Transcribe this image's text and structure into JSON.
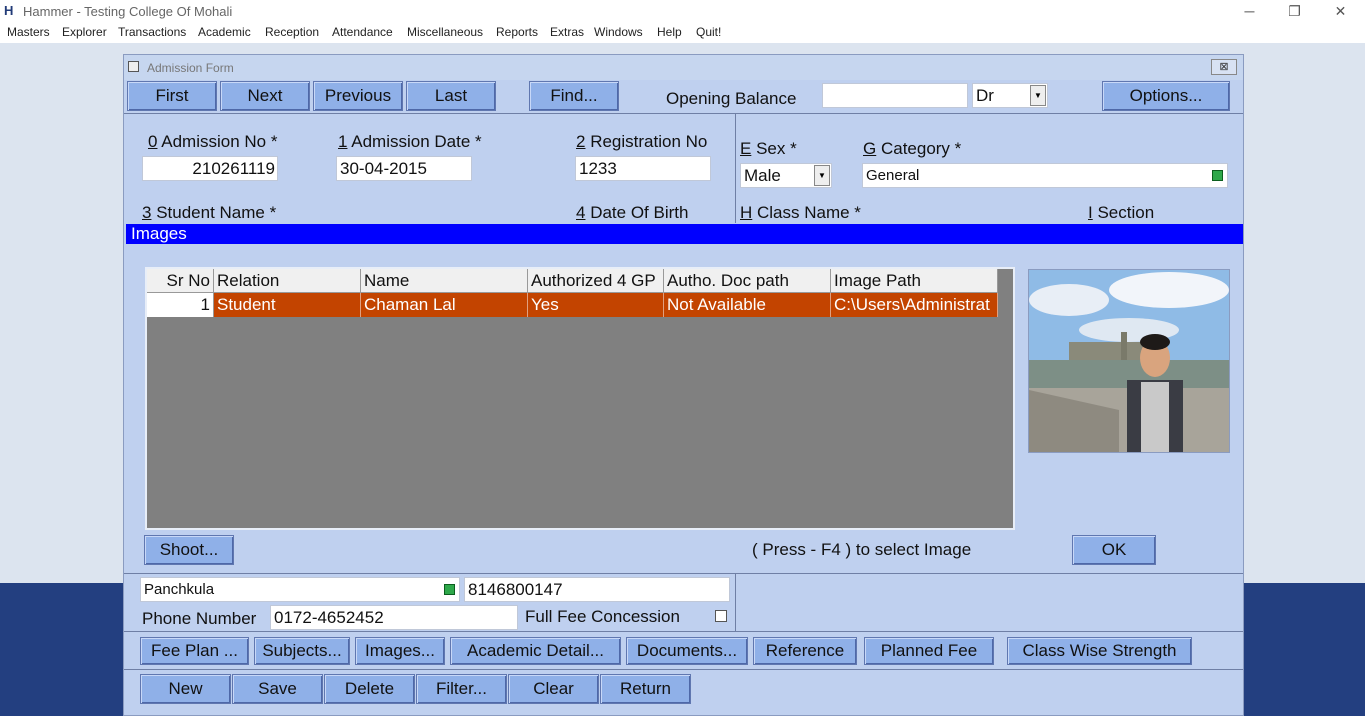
{
  "app": {
    "title": "Hammer  - Testing College Of Mohali",
    "minimize": "─",
    "restore": "❐",
    "close": "✕"
  },
  "menu": [
    "Masters",
    "Explorer",
    "Transactions",
    "Academic",
    "Reception",
    "Attendance",
    "Miscellaneous",
    "Reports",
    "Extras",
    "Windows",
    "Help",
    "Quit!"
  ],
  "form": {
    "title": "Admission Form",
    "close": "⊠"
  },
  "nav": {
    "first": "First",
    "next": "Next",
    "previous": "Previous",
    "last": "Last",
    "find": "Find...",
    "options": "Options..."
  },
  "opening_balance": {
    "label": "Opening Balance",
    "value": "",
    "drcr": "Dr"
  },
  "fields": {
    "admission_no": {
      "key": "0",
      "label": " Admission No *",
      "value": "210261119"
    },
    "admission_date": {
      "key": "1",
      "label": " Admission Date *",
      "value": "30-04-2015"
    },
    "registration_no": {
      "key": "2",
      "label": " Registration No",
      "value": "1233"
    },
    "sex": {
      "key": "E",
      "label": " Sex *",
      "value": "Male"
    },
    "category": {
      "key": "G",
      "label": " Category *",
      "value": "General"
    },
    "student_name": {
      "key": "3",
      "label": " Student Name *"
    },
    "dob": {
      "key": "4",
      "label": " Date Of Birth"
    },
    "class_name": {
      "key": "H",
      "label": " Class Name *"
    },
    "section": {
      "key": "I",
      "label": " Section"
    }
  },
  "images_panel": {
    "title": "Images",
    "columns": [
      "Sr No",
      "Relation",
      "Name",
      "Authorized 4 GP",
      "Autho. Doc path",
      "Image Path"
    ],
    "rows": [
      {
        "sr": "1",
        "relation": "Student",
        "name": "Chaman Lal",
        "authorized": "Yes",
        "doc_path": "Not Available",
        "image_path": "C:\\Users\\Administrat"
      }
    ],
    "shoot": "Shoot...",
    "hint": "( Press -  F4 )  to select  Image",
    "ok": "OK"
  },
  "lower": {
    "city": "Panchkula",
    "mobile": "8146800147",
    "phone_label": "Phone Number",
    "phone": "0172-4652452",
    "fee_concession_label": "Full Fee Concession"
  },
  "tabs": {
    "fee_plan": "Fee Plan ...",
    "subjects": "Subjects...",
    "images": "Images...",
    "academic": "Academic Detail...",
    "documents": "Documents...",
    "reference": "Reference",
    "planned_fee": "Planned Fee",
    "class_wise": "Class Wise Strength"
  },
  "actions": {
    "new": "New",
    "save": "Save",
    "delete": "Delete",
    "filter": "Filter...",
    "clear": "Clear",
    "return": "Return"
  },
  "colors": {
    "selection": "#c34400",
    "images_bar": "#0000ff",
    "button": "#8fb0e8",
    "form_bg": "#bfd0ef"
  }
}
